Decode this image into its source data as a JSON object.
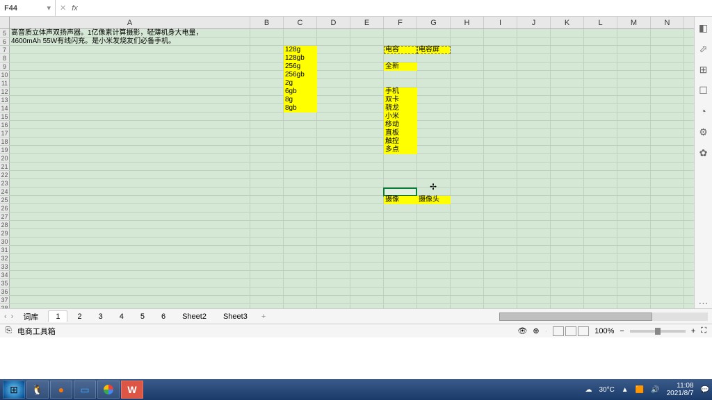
{
  "formula": {
    "cell_ref": "F44",
    "fx": "fx"
  },
  "columns": [
    "A",
    "B",
    "C",
    "D",
    "E",
    "F",
    "G",
    "H",
    "I",
    "J",
    "K",
    "L",
    "M",
    "N"
  ],
  "text_a": {
    "line1": "高音质立体声双扬声器。1亿像素计算摄影，轻薄机身大电量，",
    "line2": "4600mAh 55W有线闪充。是小米发烧友们必备手机。"
  },
  "col_c_items": [
    "128g",
    "128gb",
    "256g",
    "256gb",
    "2g",
    "6gb",
    "8g",
    "8gb"
  ],
  "f7": "电容",
  "g7": "电容屏",
  "f9": "全新",
  "col_f_items": [
    "手机",
    "双卡",
    "骁龙",
    "小米",
    "移动",
    "直板",
    "触控",
    "多点"
  ],
  "f26": "摄像",
  "g26": "摄像头",
  "tabs": {
    "items": [
      "词库",
      "1",
      "2",
      "3",
      "4",
      "5",
      "6",
      "Sheet2",
      "Sheet3"
    ],
    "active": 1
  },
  "status": {
    "left_label": "电商工具箱",
    "zoom": "100%"
  },
  "taskbar": {
    "temp": "30°C",
    "time": "11:08",
    "date": "2021/8/7"
  },
  "chart_data": null
}
